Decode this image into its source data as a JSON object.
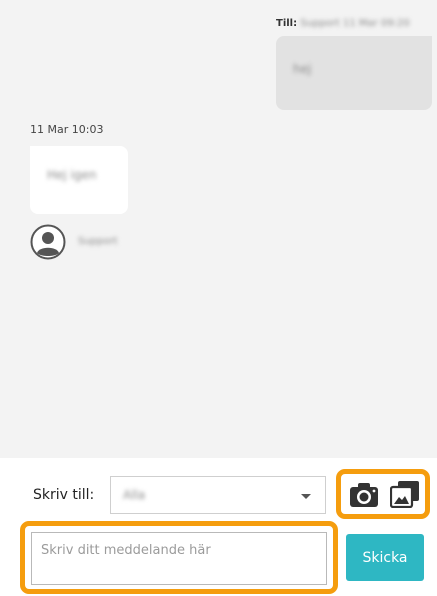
{
  "conversation": {
    "outgoing": {
      "to_label": "Till:",
      "recipient": "Support",
      "timestamp": "11 Mar 09:20",
      "text": "hej"
    },
    "incoming": {
      "timestamp": "11 Mar 10:03",
      "text": "Hej igen",
      "sender": "Support"
    }
  },
  "composer": {
    "to_label": "Skriv till:",
    "recipient_selected": "Alla",
    "message_placeholder": "Skriv ditt meddelande här",
    "send_label": "Skicka",
    "icons": [
      "camera-icon",
      "gallery-icon"
    ]
  },
  "colors": {
    "accent": "#2eb7c3",
    "highlight": "#f59d0e",
    "outgoing_bubble": "#e2e2e2",
    "incoming_bubble": "#ffffff",
    "background": "#f3f3f3"
  }
}
